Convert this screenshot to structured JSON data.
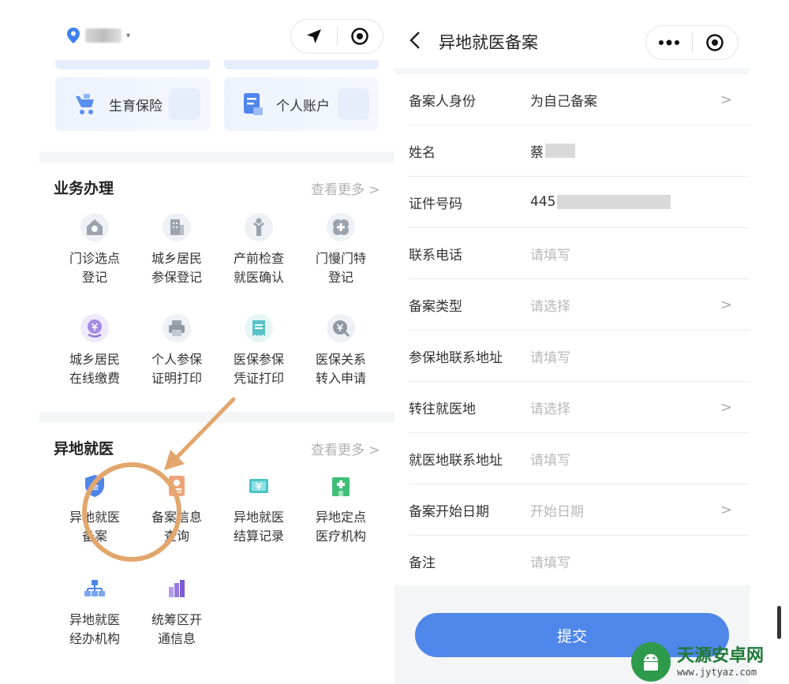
{
  "left": {
    "location_indicator": "▾",
    "insurance_cards": [
      {
        "label": "生育保险",
        "icon": "baby-carriage-icon"
      },
      {
        "label": "个人账户",
        "icon": "account-document-icon"
      }
    ],
    "business": {
      "title": "业务办理",
      "more": "查看更多 >",
      "items": [
        {
          "line1": "门诊选点",
          "line2": "登记",
          "icon": "house-icon"
        },
        {
          "line1": "城乡居民",
          "line2": "参保登记",
          "icon": "building-icon"
        },
        {
          "line1": "产前检查",
          "line2": "就医确认",
          "icon": "pregnant-person-icon"
        },
        {
          "line1": "门慢门特",
          "line2": "登记",
          "icon": "medical-cross-icon"
        },
        {
          "line1": "城乡居民",
          "line2": "在线缴费",
          "icon": "yen-coin-icon"
        },
        {
          "line1": "个人参保",
          "line2": "证明打印",
          "icon": "printer-icon"
        },
        {
          "line1": "医保参保",
          "line2": "凭证打印",
          "icon": "receipt-icon"
        },
        {
          "line1": "医保关系",
          "line2": "转入申请",
          "icon": "yen-transfer-icon"
        }
      ]
    },
    "remote": {
      "title": "异地就医",
      "more": "查看更多 >",
      "items": [
        {
          "line1": "异地就医",
          "line2": "备案",
          "icon": "shield-record-icon",
          "badge": "备"
        },
        {
          "line1": "备案信息",
          "line2": "查询",
          "icon": "id-card-icon"
        },
        {
          "line1": "异地就医",
          "line2": "结算记录",
          "icon": "yen-bill-icon"
        },
        {
          "line1": "异地定点",
          "line2": "医疗机构",
          "icon": "hospital-icon"
        },
        {
          "line1": "异地就医",
          "line2": "经办机构",
          "icon": "org-chart-icon"
        },
        {
          "line1": "统筹区开",
          "line2": "通信息",
          "icon": "bar-chart-icon"
        }
      ]
    }
  },
  "right": {
    "title": "异地就医备案",
    "form": [
      {
        "label": "备案人身份",
        "value": "为自己备案",
        "placeholder": false,
        "chevron": true
      },
      {
        "label": "姓名",
        "value": "蔡",
        "placeholder": false,
        "chevron": false,
        "redacted": true
      },
      {
        "label": "证件号码",
        "value": "445",
        "placeholder": false,
        "chevron": false,
        "redacted": true
      },
      {
        "label": "联系电话",
        "value": "请填写",
        "placeholder": true,
        "chevron": false
      },
      {
        "label": "备案类型",
        "value": "请选择",
        "placeholder": true,
        "chevron": true
      },
      {
        "label": "参保地联系地址",
        "value": "请填写",
        "placeholder": true,
        "chevron": false
      },
      {
        "label": "转往就医地",
        "value": "请选择",
        "placeholder": true,
        "chevron": true
      },
      {
        "label": "就医地联系地址",
        "value": "请填写",
        "placeholder": true,
        "chevron": false
      },
      {
        "label": "备案开始日期",
        "value": "开始日期",
        "placeholder": true,
        "chevron": true
      },
      {
        "label": "备注",
        "value": "请填写",
        "placeholder": true,
        "chevron": false
      }
    ],
    "chevron_glyph": ">",
    "submit_label": "提交"
  },
  "watermark": {
    "name": "天源安卓网",
    "url": "www.jytyaz.com"
  },
  "colors": {
    "primary": "#4f86ea",
    "highlight_ring": "#e2a66c",
    "more_text": "#b0b0b0",
    "placeholder": "#b8b8b8"
  }
}
